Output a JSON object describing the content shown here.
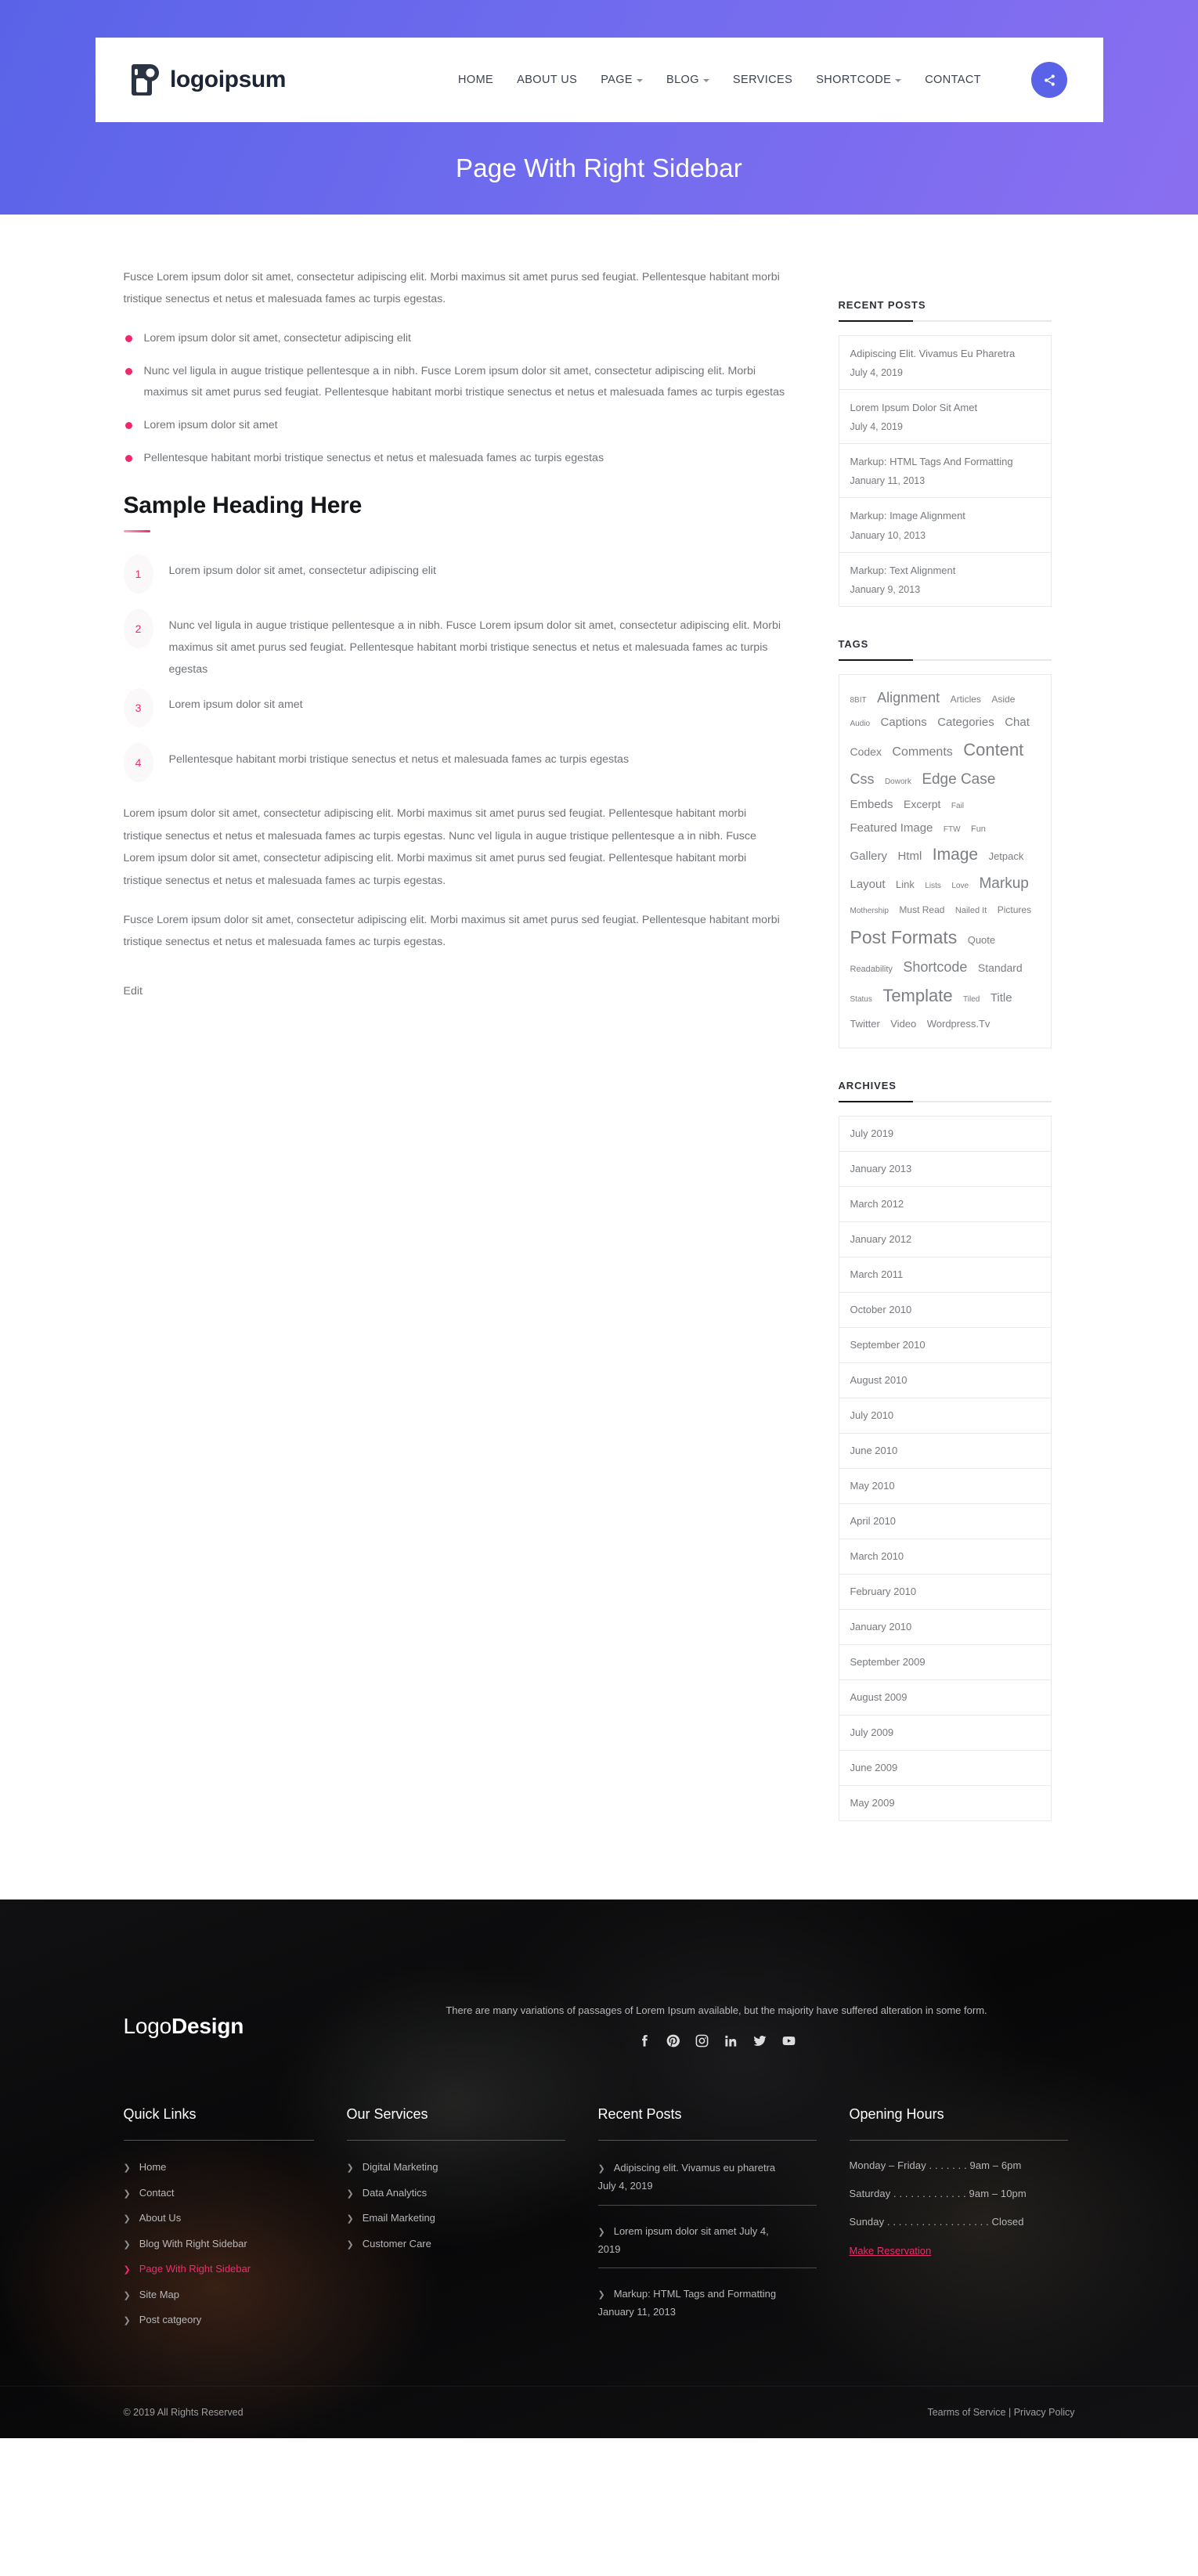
{
  "header": {
    "brand": "logoipsum",
    "nav": [
      {
        "label": "HOME",
        "caret": false
      },
      {
        "label": "ABOUT US",
        "caret": false
      },
      {
        "label": "PAGE",
        "caret": true
      },
      {
        "label": "BLOG",
        "caret": true
      },
      {
        "label": "SERVICES",
        "caret": false
      },
      {
        "label": "SHORTCODE",
        "caret": true
      },
      {
        "label": "CONTACT",
        "caret": false
      }
    ],
    "share_icon": "share-icon"
  },
  "hero": {
    "title": "Page With Right Sidebar",
    "accent": "#5a63e8"
  },
  "main": {
    "intro": "Fusce Lorem ipsum dolor sit amet, consectetur adipiscing elit. Morbi maximus sit amet purus sed feugiat. Pellentesque habitant morbi tristique senectus et netus et malesuada fames ac turpis egestas.",
    "bullets": [
      "Lorem ipsum dolor sit amet, consectetur adipiscing elit",
      "Nunc vel ligula in augue tristique pellentesque a in nibh. Fusce Lorem ipsum dolor sit amet, consectetur adipiscing elit. Morbi maximus sit amet purus sed feugiat. Pellentesque habitant morbi tristique senectus et netus et malesuada fames ac turpis egestas",
      "Lorem ipsum dolor sit amet",
      "Pellentesque habitant morbi tristique senectus et netus et malesuada fames ac turpis egestas"
    ],
    "heading": "Sample Heading Here",
    "numbered": [
      {
        "num": "1",
        "text": "Lorem ipsum dolor sit amet, consectetur adipiscing elit"
      },
      {
        "num": "2",
        "text": "Nunc vel ligula in augue tristique pellentesque a in nibh. Fusce Lorem ipsum dolor sit amet, consectetur adipiscing elit. Morbi maximus sit amet purus sed feugiat. Pellentesque habitant morbi tristique senectus et netus et malesuada fames ac turpis egestas"
      },
      {
        "num": "3",
        "text": "Lorem ipsum dolor sit amet"
      },
      {
        "num": "4",
        "text": "Pellentesque habitant morbi tristique senectus et netus et malesuada fames ac turpis egestas"
      }
    ],
    "para2": "Lorem ipsum dolor sit amet, consectetur adipiscing elit. Morbi maximus sit amet purus sed feugiat. Pellentesque habitant morbi tristique senectus et netus et malesuada fames ac turpis egestas. Nunc vel ligula in augue tristique pellentesque a in nibh. Fusce Lorem ipsum dolor sit amet, consectetur adipiscing elit. Morbi maximus sit amet purus sed feugiat. Pellentesque habitant morbi tristique senectus et netus et malesuada fames ac turpis egestas.",
    "para3": "Fusce Lorem ipsum dolor sit amet, consectetur adipiscing elit. Morbi maximus sit amet purus sed feugiat. Pellentesque habitant morbi tristique senectus et netus et malesuada fames ac turpis egestas.",
    "edit_label": "Edit"
  },
  "sidebar": {
    "recent_posts_title": "RECENT POSTS",
    "recent_posts": [
      {
        "title": "Adipiscing Elit. Vivamus Eu Pharetra",
        "date": "July 4, 2019"
      },
      {
        "title": "Lorem Ipsum Dolor Sit Amet",
        "date": "July 4, 2019"
      },
      {
        "title": "Markup: HTML Tags And Formatting",
        "date": "January 11, 2013"
      },
      {
        "title": "Markup: Image Alignment",
        "date": "January 10, 2013"
      },
      {
        "title": "Markup: Text Alignment",
        "date": "January 9, 2013"
      }
    ],
    "tags_title": "TAGS",
    "tags": [
      {
        "label": "8BIT",
        "size": 10
      },
      {
        "label": "Alignment",
        "size": 18
      },
      {
        "label": "Articles",
        "size": 12
      },
      {
        "label": "Aside",
        "size": 12
      },
      {
        "label": "Audio",
        "size": 10
      },
      {
        "label": "Captions",
        "size": 15
      },
      {
        "label": "Categories",
        "size": 15
      },
      {
        "label": "Chat",
        "size": 15
      },
      {
        "label": "Codex",
        "size": 14
      },
      {
        "label": "Comments",
        "size": 16
      },
      {
        "label": "Content",
        "size": 22
      },
      {
        "label": "Css",
        "size": 18
      },
      {
        "label": "Dowork",
        "size": 10
      },
      {
        "label": "Edge Case",
        "size": 19
      },
      {
        "label": "Embeds",
        "size": 15
      },
      {
        "label": "Excerpt",
        "size": 14
      },
      {
        "label": "Fail",
        "size": 10
      },
      {
        "label": "Featured Image",
        "size": 15
      },
      {
        "label": "FTW",
        "size": 10
      },
      {
        "label": "Fun",
        "size": 11
      },
      {
        "label": "Gallery",
        "size": 15
      },
      {
        "label": "Html",
        "size": 15
      },
      {
        "label": "Image",
        "size": 21
      },
      {
        "label": "Jetpack",
        "size": 13
      },
      {
        "label": "Layout",
        "size": 15
      },
      {
        "label": "Link",
        "size": 13
      },
      {
        "label": "Lists",
        "size": 10
      },
      {
        "label": "Love",
        "size": 10
      },
      {
        "label": "Markup",
        "size": 19
      },
      {
        "label": "Mothership",
        "size": 10
      },
      {
        "label": "Must Read",
        "size": 12
      },
      {
        "label": "Nailed It",
        "size": 11
      },
      {
        "label": "Pictures",
        "size": 12
      },
      {
        "label": "Post Formats",
        "size": 23
      },
      {
        "label": "Quote",
        "size": 13
      },
      {
        "label": "Readability",
        "size": 11
      },
      {
        "label": "Shortcode",
        "size": 18
      },
      {
        "label": "Standard",
        "size": 14
      },
      {
        "label": "Status",
        "size": 10
      },
      {
        "label": "Template",
        "size": 22
      },
      {
        "label": "Tiled",
        "size": 10
      },
      {
        "label": "Title",
        "size": 15
      },
      {
        "label": "Twitter",
        "size": 13
      },
      {
        "label": "Video",
        "size": 13
      },
      {
        "label": "Wordpress.Tv",
        "size": 13
      }
    ],
    "archives_title": "ARCHIVES",
    "archives": [
      "July 2019",
      "January 2013",
      "March 2012",
      "January 2012",
      "March 2011",
      "October 2010",
      "September 2010",
      "August 2010",
      "July 2010",
      "June 2010",
      "May 2010",
      "April 2010",
      "March 2010",
      "February 2010",
      "January 2010",
      "September 2009",
      "August 2009",
      "July 2009",
      "June 2009",
      "May 2009"
    ]
  },
  "footer": {
    "logo_light": "Logo",
    "logo_bold": "Design",
    "intro": "There are many variations of passages of Lorem Ipsum available, but the majority have suffered alteration in some form.",
    "socials": [
      "facebook-icon",
      "pinterest-icon",
      "instagram-icon",
      "linkedin-icon",
      "twitter-icon",
      "youtube-icon"
    ],
    "quick_links_title": "Quick Links",
    "quick_links": [
      {
        "label": "Home",
        "active": false
      },
      {
        "label": "Contact",
        "active": false
      },
      {
        "label": "About Us",
        "active": false
      },
      {
        "label": "Blog With Right Sidebar",
        "active": false
      },
      {
        "label": "Page With Right Sidebar",
        "active": true
      },
      {
        "label": "Site Map",
        "active": false
      },
      {
        "label": "Post catgeory",
        "active": false
      }
    ],
    "services_title": "Our Services",
    "services": [
      {
        "label": "Digital Marketing"
      },
      {
        "label": "Data Analytics"
      },
      {
        "label": "Email Marketing"
      },
      {
        "label": "Customer Care"
      }
    ],
    "recent_title": "Recent Posts",
    "recent": [
      {
        "title": "Adipiscing elit. Vivamus eu pharetra",
        "date": "July 4, 2019"
      },
      {
        "title": "Lorem ipsum dolor sit amet July 4,",
        "date": "2019"
      },
      {
        "title": "Markup: HTML Tags and Formatting",
        "date": "January 11, 2013"
      }
    ],
    "hours_title": "Opening Hours",
    "hours": [
      "Monday – Friday . . . . . . . 9am – 6pm",
      "Saturday . . . . . . . . . . . . . 9am – 10pm",
      "Sunday . . . . . . . . . . . . . . . . . . Closed"
    ],
    "reserve_label": "Make Reservation",
    "copyright": "© 2019 All Rights Reserved",
    "legal_terms": "Tearms of Service",
    "legal_sep": "|",
    "legal_privacy": "Privacy Policy",
    "accent": "#ef2a6f"
  }
}
